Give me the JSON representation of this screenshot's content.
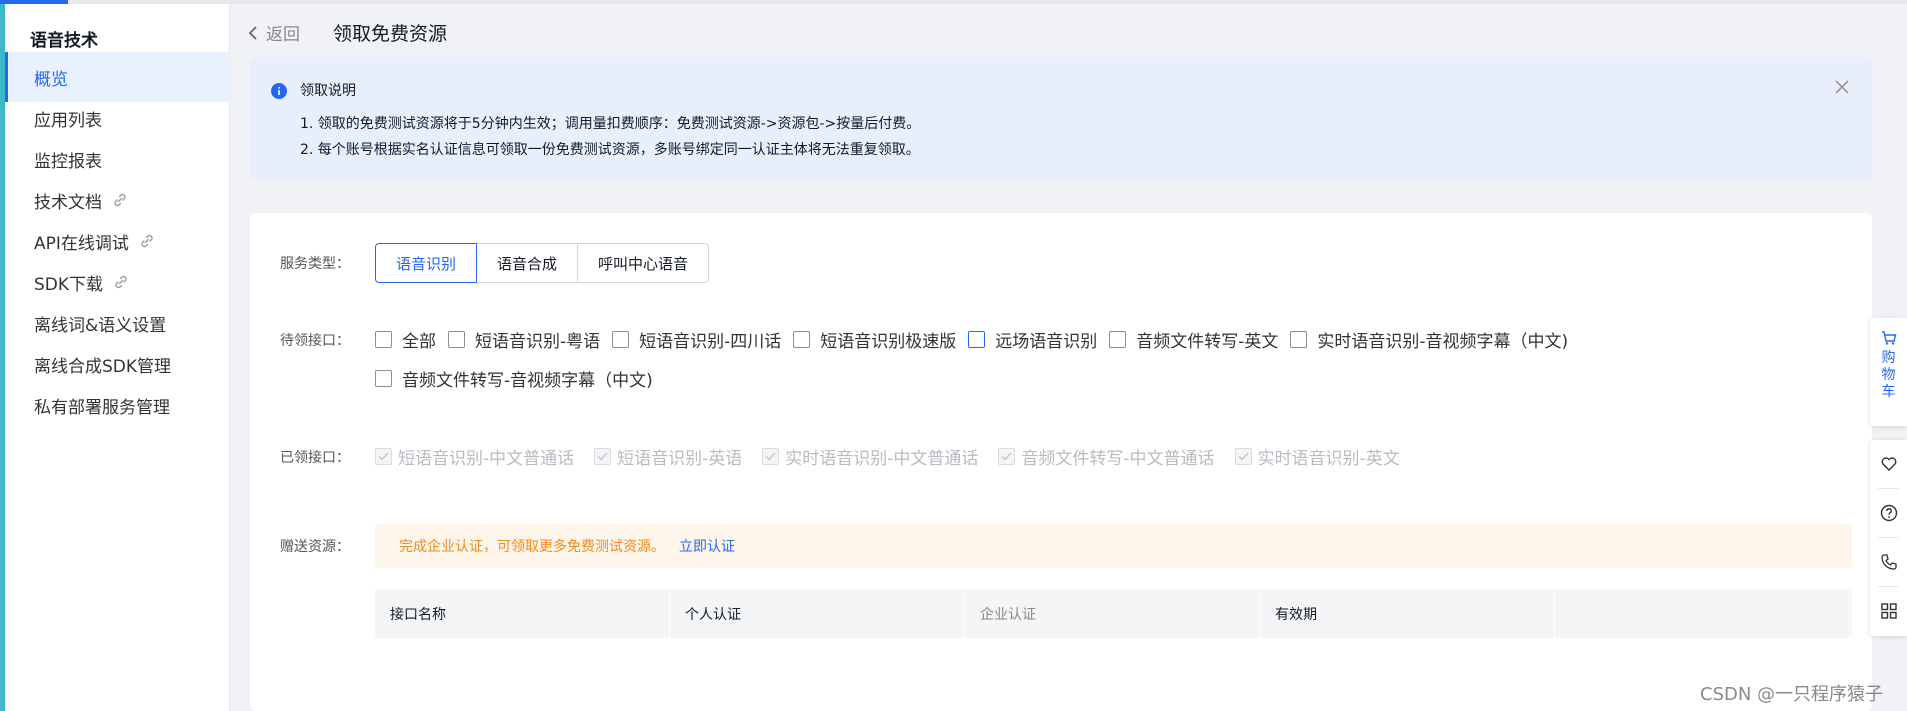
{
  "colors": {
    "brand": "#2468f2",
    "warning_text": "#f28b1e",
    "notice_bg": "#e8eefa",
    "gift_bg": "#fdf5ea"
  },
  "sidebar": {
    "title": "语音技术",
    "items": [
      {
        "label": "概览",
        "active": true
      },
      {
        "label": "应用列表"
      },
      {
        "label": "监控报表"
      },
      {
        "label": "技术文档",
        "icon": "link-icon"
      },
      {
        "label": "API在线调试",
        "icon": "link-icon"
      },
      {
        "label": "SDK下载",
        "icon": "link-icon"
      },
      {
        "label": "离线词&语义设置"
      },
      {
        "label": "离线合成SDK管理"
      },
      {
        "label": "私有部署服务管理"
      }
    ]
  },
  "header": {
    "back_label": "返回",
    "title": "领取免费资源"
  },
  "notice": {
    "title": "领取说明",
    "lines": [
      "1. 领取的免费测试资源将于5分钟内生效；调用量扣费顺序：免费测试资源->资源包->按量后付费。",
      "2. 每个账号根据实名认证信息可领取一份免费测试资源，多账号绑定同一认证主体将无法重复领取。"
    ]
  },
  "form": {
    "service_type_label": "服务类型：",
    "service_types": [
      "语音识别",
      "语音合成",
      "呼叫中心语音"
    ],
    "service_type_selected": "语音识别",
    "pending_label": "待领接口：",
    "pending_interfaces": [
      "全部",
      "短语音识别-粤语",
      "短语音识别-四川话",
      "短语音识别极速版",
      "远场语音识别",
      "音频文件转写-英文",
      "实时语音识别-音视频字幕（中文)",
      "音频文件转写-音视频字幕（中文)"
    ],
    "claimed_label": "已领接口：",
    "claimed_interfaces": [
      "短语音识别-中文普通话",
      "短语音识别-英语",
      "实时语音识别-中文普通话",
      "音频文件转写-中文普通话",
      "实时语音识别-英文"
    ],
    "gift_label": "赠送资源：",
    "gift_text": "完成企业认证，可领取更多免费测试资源。",
    "gift_link": "立即认证",
    "table_headers": [
      "接口名称",
      "个人认证",
      "企业认证",
      "有效期",
      ""
    ]
  },
  "right_bar": {
    "cart_label": "购物车",
    "tools": [
      "heart-icon",
      "help-icon",
      "phone-icon",
      "apps-icon"
    ]
  },
  "watermark": "CSDN @一只程序猿子"
}
